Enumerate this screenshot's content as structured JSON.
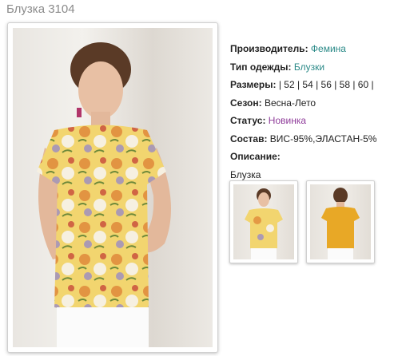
{
  "page": {
    "title": "Блузка 3104"
  },
  "product": {
    "manufacturer": {
      "label": "Производитель:",
      "value": "Фемина"
    },
    "type": {
      "label": "Тип одежды:",
      "value": "Блузки"
    },
    "sizes": {
      "label": "Размеры:",
      "value": "| 52 | 54 | 56 | 58 | 60 |"
    },
    "season": {
      "label": "Сезон:",
      "value": "Весна-Лето"
    },
    "status": {
      "label": "Статус:",
      "value": "Новинка"
    },
    "composition": {
      "label": "Состав:",
      "value": "ВИС-95%,ЭЛАСТАН-5%"
    },
    "description": {
      "label": "Описание:",
      "value": "Блузка"
    }
  },
  "colors": {
    "link": "#2b8a88",
    "status": "#8f3c9a",
    "title": "#8a8a8a",
    "blouse_print": "#f1d36a",
    "blouse_back": "#e8a826"
  },
  "gallery": {
    "main_image": "woman-floral-blouse-front-photo",
    "thumbnails": [
      "blouse-front-thumbnail",
      "blouse-back-thumbnail"
    ]
  }
}
